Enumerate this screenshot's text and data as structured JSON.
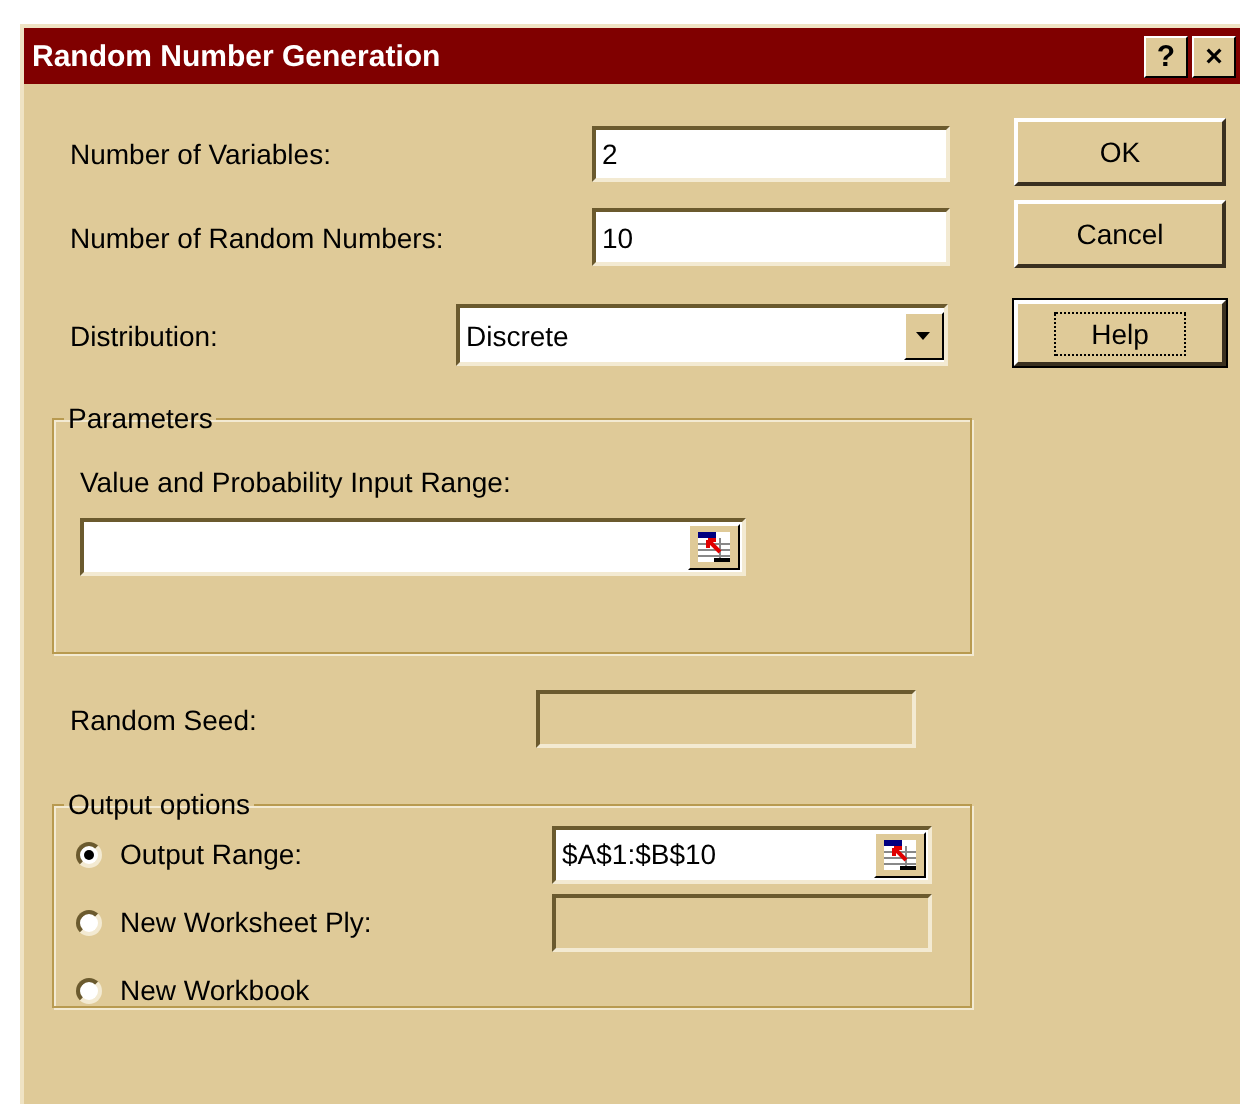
{
  "window": {
    "title": "Random Number Generation",
    "controls": [
      "?",
      "×"
    ]
  },
  "fields": [
    {
      "label": "Number of Variables:",
      "value": "2"
    },
    {
      "label": "Number of Random Numbers:",
      "value": "10"
    }
  ],
  "distribution": {
    "label": "Distribution:",
    "value": "Discrete"
  },
  "parameters": {
    "title": "Parameters",
    "label": "Value and Probability Input Range:"
  },
  "random_seed": {
    "label": "Random Seed:",
    "disabled": true
  },
  "output_options": {
    "title": "Output options",
    "options": [
      {
        "kind": "range",
        "label": "Output Range:",
        "selected": true,
        "value": "$A$1:$B$10",
        "disabled": false
      },
      {
        "kind": "text",
        "label": "New Worksheet Ply:",
        "selected": false,
        "disabled": true
      },
      {
        "kind": "none",
        "label": "New Workbook",
        "selected": false
      }
    ]
  },
  "buttons": [
    {
      "label": "OK",
      "focused": false
    },
    {
      "label": "Cancel",
      "focused": false
    },
    {
      "label": "Help",
      "focused": true
    }
  ]
}
